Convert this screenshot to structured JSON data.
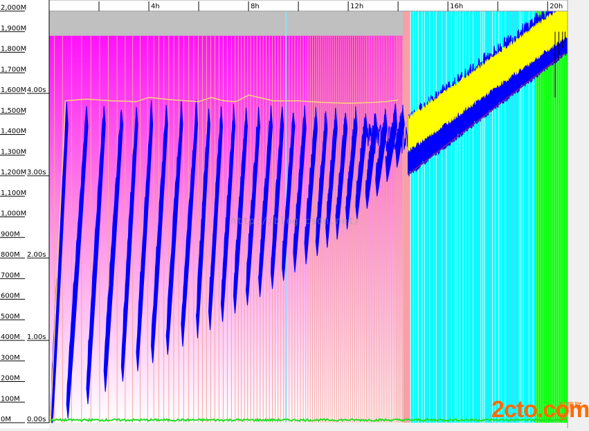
{
  "chart_data": {
    "type": "line",
    "title": "",
    "x_axis": {
      "unit": "hours",
      "range": [
        0,
        20.8
      ],
      "labeled_ticks": [
        {
          "value": 4,
          "label": "4h"
        },
        {
          "value": 8,
          "label": "8h"
        },
        {
          "value": 12,
          "label": "12h"
        },
        {
          "value": 16,
          "label": "16h"
        },
        {
          "value": 20,
          "label": "20h"
        }
      ],
      "minor_ticks": [
        2,
        6,
        10,
        14,
        18
      ]
    },
    "y_axis_memory": {
      "range": [
        0,
        2000
      ],
      "ticks": [
        {
          "value": 0,
          "label": "0M"
        },
        {
          "value": 100,
          "label": "100M"
        },
        {
          "value": 200,
          "label": "200M"
        },
        {
          "value": 300,
          "label": "300M"
        },
        {
          "value": 400,
          "label": "400M"
        },
        {
          "value": 500,
          "label": "500M"
        },
        {
          "value": 600,
          "label": "600M"
        },
        {
          "value": 700,
          "label": "700M"
        },
        {
          "value": 800,
          "label": "800M"
        },
        {
          "value": 900,
          "label": "900M"
        },
        {
          "value": 1000,
          "label": "1,000M"
        },
        {
          "value": 1100,
          "label": "1,100M"
        },
        {
          "value": 1200,
          "label": "1,200M"
        },
        {
          "value": 1300,
          "label": "1,300M"
        },
        {
          "value": 1400,
          "label": "1,400M"
        },
        {
          "value": 1500,
          "label": "1,500M"
        },
        {
          "value": 1600,
          "label": "1,600M"
        },
        {
          "value": 1700,
          "label": "1,700M"
        },
        {
          "value": 1800,
          "label": "1,800M"
        },
        {
          "value": 1900,
          "label": "1,900M"
        },
        {
          "value": 2000,
          "label": "2,000M"
        }
      ]
    },
    "y_axis_time": {
      "range": [
        0,
        5.0
      ],
      "ticks": [
        {
          "value": 0,
          "label": "0.00s"
        },
        {
          "value": 1,
          "label": "1.00s"
        },
        {
          "value": 2,
          "label": "2.00s"
        },
        {
          "value": 3,
          "label": "3.00s"
        },
        {
          "value": 4,
          "label": "4.00s"
        }
      ]
    },
    "heap_capacity_band": {
      "from_hour": 0,
      "to_hour": 14.2,
      "level_memory": 1880,
      "top_memory": 2000,
      "color": "#c0c0c0"
    },
    "collection_phases": [
      {
        "name": "phase-1",
        "from_hour": 0,
        "to_hour": 14.2,
        "color": "#ff00ff"
      },
      {
        "name": "phase-2",
        "from_hour": 14.2,
        "to_hour": 14.5,
        "color": "#f7a0a8"
      },
      {
        "name": "phase-3",
        "from_hour": 14.5,
        "to_hour": 19.5,
        "color": "#00ffff"
      },
      {
        "name": "phase-4",
        "from_hour": 19.5,
        "to_hour": 20.8,
        "color": "#00ff00"
      }
    ],
    "series": [
      {
        "color": "#0000ff",
        "sawtooth_cycles": [
          {
            "start": 0.05,
            "end": 0.7,
            "low": 30,
            "high": 1540
          },
          {
            "start": 0.7,
            "end": 1.5,
            "low": 110,
            "high": 1530
          },
          {
            "start": 1.5,
            "end": 2.2,
            "low": 180,
            "high": 1540
          },
          {
            "start": 2.2,
            "end": 2.9,
            "low": 240,
            "high": 1540
          },
          {
            "start": 2.9,
            "end": 3.5,
            "low": 290,
            "high": 1540
          },
          {
            "start": 3.5,
            "end": 4.1,
            "low": 340,
            "high": 1540
          },
          {
            "start": 4.1,
            "end": 4.7,
            "low": 380,
            "high": 1540
          },
          {
            "start": 4.7,
            "end": 5.3,
            "low": 420,
            "high": 1540
          },
          {
            "start": 5.3,
            "end": 5.9,
            "low": 460,
            "high": 1540
          },
          {
            "start": 5.9,
            "end": 6.4,
            "low": 500,
            "high": 1540
          },
          {
            "start": 6.4,
            "end": 6.9,
            "low": 540,
            "high": 1530
          },
          {
            "start": 6.9,
            "end": 7.4,
            "low": 580,
            "high": 1530
          },
          {
            "start": 7.4,
            "end": 7.9,
            "low": 620,
            "high": 1530
          },
          {
            "start": 7.9,
            "end": 8.4,
            "low": 660,
            "high": 1530
          },
          {
            "start": 8.4,
            "end": 8.9,
            "low": 700,
            "high": 1530
          },
          {
            "start": 8.9,
            "end": 9.35,
            "low": 740,
            "high": 1530
          },
          {
            "start": 9.35,
            "end": 9.8,
            "low": 780,
            "high": 1530
          },
          {
            "start": 9.8,
            "end": 10.25,
            "low": 820,
            "high": 1520
          },
          {
            "start": 10.25,
            "end": 10.7,
            "low": 860,
            "high": 1520
          },
          {
            "start": 10.7,
            "end": 11.1,
            "low": 900,
            "high": 1520
          },
          {
            "start": 11.1,
            "end": 11.5,
            "low": 940,
            "high": 1520
          },
          {
            "start": 11.5,
            "end": 11.9,
            "low": 980,
            "high": 1520
          },
          {
            "start": 11.9,
            "end": 12.3,
            "low": 1030,
            "high": 1520
          },
          {
            "start": 12.3,
            "end": 12.7,
            "low": 1080,
            "high": 1520
          },
          {
            "start": 12.7,
            "end": 13.1,
            "low": 1130,
            "high": 1520
          },
          {
            "start": 13.1,
            "end": 13.5,
            "low": 1190,
            "high": 1520
          },
          {
            "start": 13.5,
            "end": 13.9,
            "low": 1260,
            "high": 1530
          },
          {
            "start": 13.9,
            "end": 14.2,
            "low": 1330,
            "high": 1540
          }
        ],
        "linear_growth": {
          "from": [
            14.4,
            1380
          ],
          "to": [
            20.8,
            1980
          ],
          "band_memory": 250
        }
      },
      {
        "color": "#ffff00",
        "linear_growth": {
          "from": [
            14.4,
            1400
          ],
          "to": [
            20.8,
            1960
          ],
          "band_memory": 160
        }
      },
      {
        "color": "#ffd280",
        "scale": "time",
        "x": [
          0.65,
          1.5,
          2.5,
          3.5,
          4.0,
          5.0,
          6.0,
          6.5,
          7.0,
          7.5,
          8.0,
          9.0,
          10.0,
          11.0,
          12.0,
          13.0,
          13.5,
          14.0
        ],
        "y": [
          3.91,
          3.93,
          3.91,
          3.9,
          3.95,
          3.92,
          3.9,
          3.95,
          3.91,
          3.9,
          3.98,
          3.91,
          3.91,
          3.89,
          3.88,
          3.89,
          3.9,
          3.92
        ]
      },
      {
        "color": "#00ff00",
        "scale": "time",
        "baseline": 0.02
      }
    ]
  },
  "watermark": "http://blog.csdn.net/",
  "logo": {
    "main": "2cto",
    "suffix": ".com",
    "sub": "红黑联盟"
  }
}
